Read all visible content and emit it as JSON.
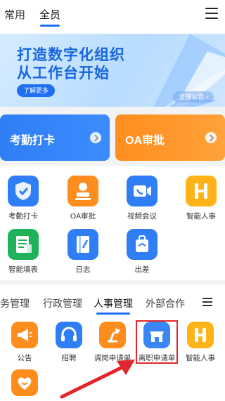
{
  "top_tabs": [
    {
      "label": "常用"
    },
    {
      "label": "全员"
    }
  ],
  "banner": {
    "line1": "打造数字化组织",
    "line2": "从工作台开始",
    "learn_more": "了解更多",
    "all_notices": "全部公告",
    "arrow_glyph": "›"
  },
  "big_cards": [
    {
      "label": "考勤打卡",
      "color": "#2f7ef5"
    },
    {
      "label": "OA审批",
      "color": "#ff8d1e"
    }
  ],
  "apps": [
    {
      "label": "考勤打卡",
      "color": "#2f7ef5",
      "icon": "shield-check-icon"
    },
    {
      "label": "OA审批",
      "color": "#ff8d1e",
      "icon": "person-stamp-icon"
    },
    {
      "label": "视频会议",
      "color": "#2f7ef5",
      "icon": "video-phone-icon"
    },
    {
      "label": "智能人事",
      "color": "#ffb31a",
      "icon": "h-letter-icon"
    },
    {
      "label": "智能填表",
      "color": "#20b25b",
      "icon": "form-icon"
    },
    {
      "label": "日志",
      "color": "#2f7ef5",
      "icon": "log-book-icon"
    },
    {
      "label": "出差",
      "color": "#2f7ef5",
      "icon": "suitcase-icon"
    }
  ],
  "category_tabs": [
    {
      "label": "务管理"
    },
    {
      "label": "行政管理"
    },
    {
      "label": "人事管理"
    },
    {
      "label": "外部合作"
    }
  ],
  "hr_apps": [
    {
      "label": "公告",
      "color": "#ff8d1e",
      "icon": "megaphone-icon"
    },
    {
      "label": "招聘",
      "color": "#2f7ef5",
      "icon": "headset-icon"
    },
    {
      "label": "调岗申请单",
      "color": "#ff8d1e",
      "icon": "desk-lamp-icon"
    },
    {
      "label": "离职申请单",
      "color": "#3b86f5",
      "icon": "store-icon"
    },
    {
      "label": "智能人事",
      "color": "#ffb31a",
      "icon": "h-letter-icon"
    },
    {
      "label": "",
      "color": "#ff8d1e",
      "icon": "heart-icon"
    }
  ]
}
